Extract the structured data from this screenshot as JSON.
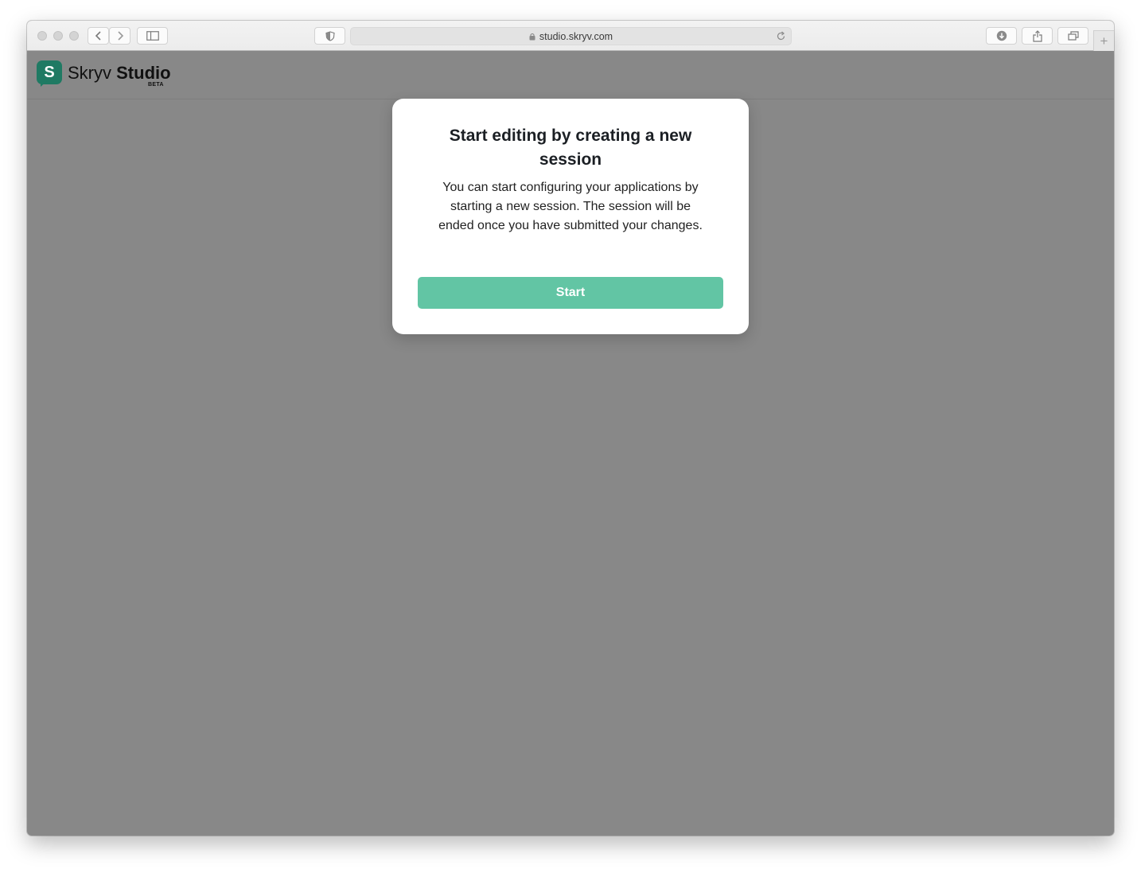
{
  "browser": {
    "url": "studio.skryv.com",
    "new_tab_label": "+"
  },
  "app": {
    "logo_letter": "S",
    "brand_name": "Skryv",
    "product_name": "Studio",
    "badge": "BETA",
    "brand_color": "#1f7a63"
  },
  "modal": {
    "title": "Start editing by creating a new session",
    "body": "You can start configuring your applications by starting a new session. The session will be ended once you have submitted your changes.",
    "start_label": "Start",
    "button_color": "#62c5a4"
  },
  "icons": [
    "close-dot-icon",
    "minimize-dot-icon",
    "zoom-dot-icon",
    "back-icon",
    "forward-icon",
    "sidebar-icon",
    "privacy-shield-icon",
    "lock-icon",
    "reload-icon",
    "download-icon",
    "share-icon",
    "tabs-icon",
    "new-tab-icon"
  ]
}
